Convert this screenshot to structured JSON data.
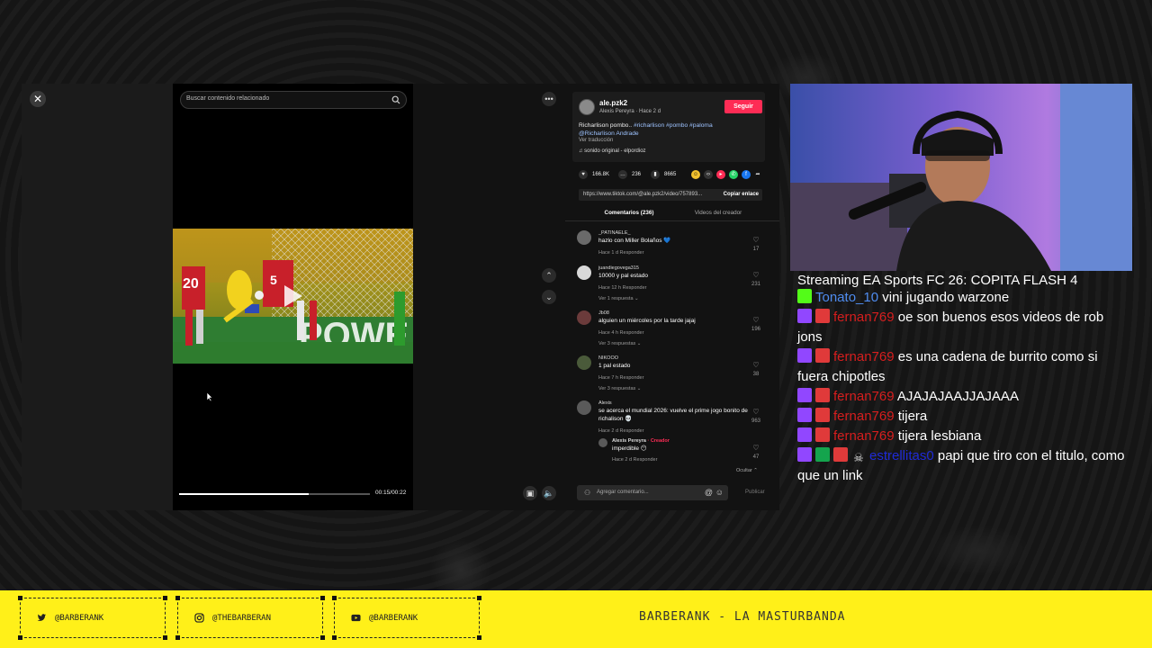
{
  "player": {
    "search_placeholder": "Buscar contenido relacionado",
    "time": "00:15/00:22",
    "progress": 0.68
  },
  "post": {
    "username": "ale.pzk2",
    "meta": "Alexis Pereyra · Hace 2 d",
    "follow_label": "Seguir",
    "description_plain": "Richarlison pombo.. ",
    "description_tags": "#richarlison #pombo #paloma",
    "description_mention": "@Richarlison Andrade",
    "translate_label": "Ver traducción",
    "sound": "sonido original - elpordioz",
    "likes": "166.8K",
    "comments_count": "236",
    "saves": "8665",
    "link_url": "https://www.tiktok.com/@ale.pzk2/video/757893...",
    "copy_label": "Copiar enlace",
    "tab_comments": "Comentarios (236)",
    "tab_videos": "Videos del creador"
  },
  "comments": [
    {
      "user": "_PATINAELE_",
      "text": "hazlo con Miller Bolaños 💙",
      "meta": "Hace 1 d     Responder",
      "replies": "",
      "likes": "17",
      "color": "#6a6a6a"
    },
    {
      "user": "juandiegovega315",
      "text": "10000 y pal estado",
      "meta": "Hace 12 h     Responder",
      "replies": "Ver 1 respuesta ⌄",
      "likes": "231",
      "color": "#d8d8d8"
    },
    {
      "user": "Jb08",
      "text": "alguien un miércoles por la tarde jajaj",
      "meta": "Hace 4 h     Responder",
      "replies": "Ver 3 respuestas ⌄",
      "likes": "196",
      "color": "#6b3b3b"
    },
    {
      "user": "NIKOOO",
      "text": "1 pal estado",
      "meta": "Hace 7 h     Responder",
      "replies": "Ver 3 respuestas ⌄",
      "likes": "38",
      "color": "#4a5a3a"
    },
    {
      "user": "Alexis",
      "text": "se acerca el mundial 2026: vuelve el prime jogo bonito de richalison 💀",
      "meta": "Hace 2 d     Responder",
      "replies": "",
      "likes": "963",
      "color": "#5a5a5a"
    }
  ],
  "reply": {
    "user": "Alexis Pereyra",
    "creator_tag": "· Creador",
    "text": "imperdible 😶",
    "meta": "Hace 2 d     Responder",
    "likes": "47"
  },
  "hide_label": "Ocultar ⌃",
  "add_comment_placeholder": "Agregar comentario...",
  "publish_label": "Publicar",
  "chat": {
    "title": "Streaming EA Sports FC 26: COPITA FLASH 4",
    "messages": [
      {
        "badges": [
          "kk"
        ],
        "user": "Tonato_10",
        "user_color": "#4f8cf0",
        "text": " vini jugando warzone"
      },
      {
        "badges": [
          "tw",
          "mod"
        ],
        "user": "fernan769",
        "user_color": "#d61e1e",
        "text": " oe son buenos esos videos de rob jons"
      },
      {
        "badges": [
          "tw",
          "mod"
        ],
        "user": "fernan769",
        "user_color": "#d61e1e",
        "text": " es una cadena de burrito como si fuera chipotles"
      },
      {
        "badges": [
          "tw",
          "mod"
        ],
        "user": "fernan769",
        "user_color": "#d61e1e",
        "text": " AJAJAJAAJJAJAAA"
      },
      {
        "badges": [
          "tw",
          "mod"
        ],
        "user": "fernan769",
        "user_color": "#d61e1e",
        "text": " tijera"
      },
      {
        "badges": [
          "tw",
          "mod"
        ],
        "user": "fernan769",
        "user_color": "#d61e1e",
        "text": " tijera lesbiana"
      },
      {
        "badges": [
          "tw",
          "sub",
          "mod",
          "skull"
        ],
        "user": "estrellitas0",
        "user_color": "#1f2ad6",
        "text": " papi que tiro con el titulo, como que un link"
      }
    ]
  },
  "banner": {
    "twitter": "@BARBERANK",
    "instagram": "@THEBARBERAN",
    "youtube": "@BARBERANK",
    "title": "BARBERANK - LA MASTURBANDA"
  },
  "colors": {
    "banner_bg": "#fff019",
    "follow": "#fe2c55",
    "twitch": "#9147ff",
    "kick": "#53fc18"
  }
}
